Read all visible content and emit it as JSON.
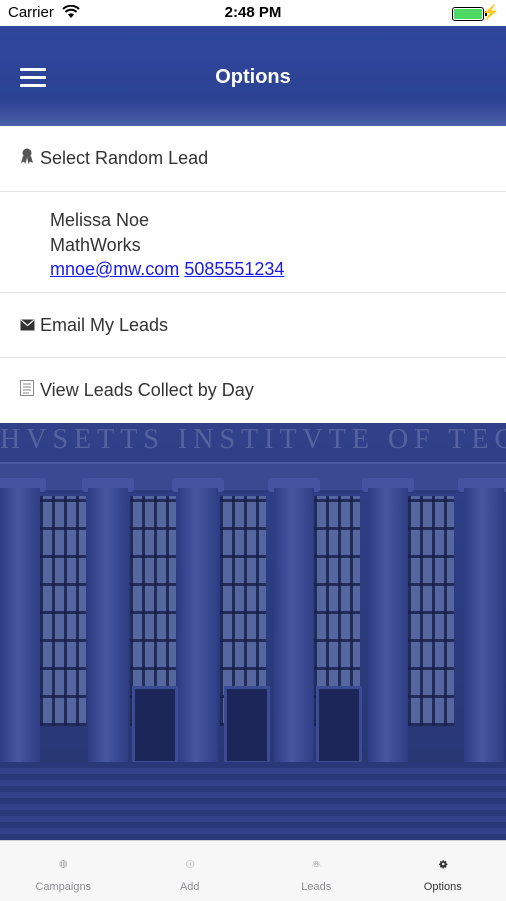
{
  "status_bar": {
    "carrier": "Carrier",
    "time": "2:48 PM"
  },
  "nav": {
    "title": "Options",
    "menu_icon": "hamburger-menu-icon"
  },
  "background": {
    "inscription": "HVSETTS INSTITVTE OF TECH"
  },
  "options": {
    "select_random_lead": {
      "icon": "award-ribbon-icon",
      "label": "Select Random Lead"
    },
    "lead": {
      "name": "Melissa Noe",
      "company": "MathWorks",
      "email": "mnoe@mw.com",
      "phone": "5085551234"
    },
    "email_my_leads": {
      "icon": "envelope-icon",
      "label": "Email My Leads"
    },
    "view_leads_by_day": {
      "icon": "list-document-icon",
      "label": "View Leads Collect by Day"
    }
  },
  "tabs": [
    {
      "label": "Campaigns",
      "icon": "globe-icon"
    },
    {
      "label": "Add",
      "icon": "plus-circle-icon"
    },
    {
      "label": "Leads",
      "icon": "people-icon"
    },
    {
      "label": "Options",
      "icon": "gear-icon",
      "active": true
    }
  ],
  "colors": {
    "nav": "#2f469c",
    "tab_active": "#333333",
    "tab_inactive": "#8e8e93",
    "link": "#1a1aee"
  }
}
